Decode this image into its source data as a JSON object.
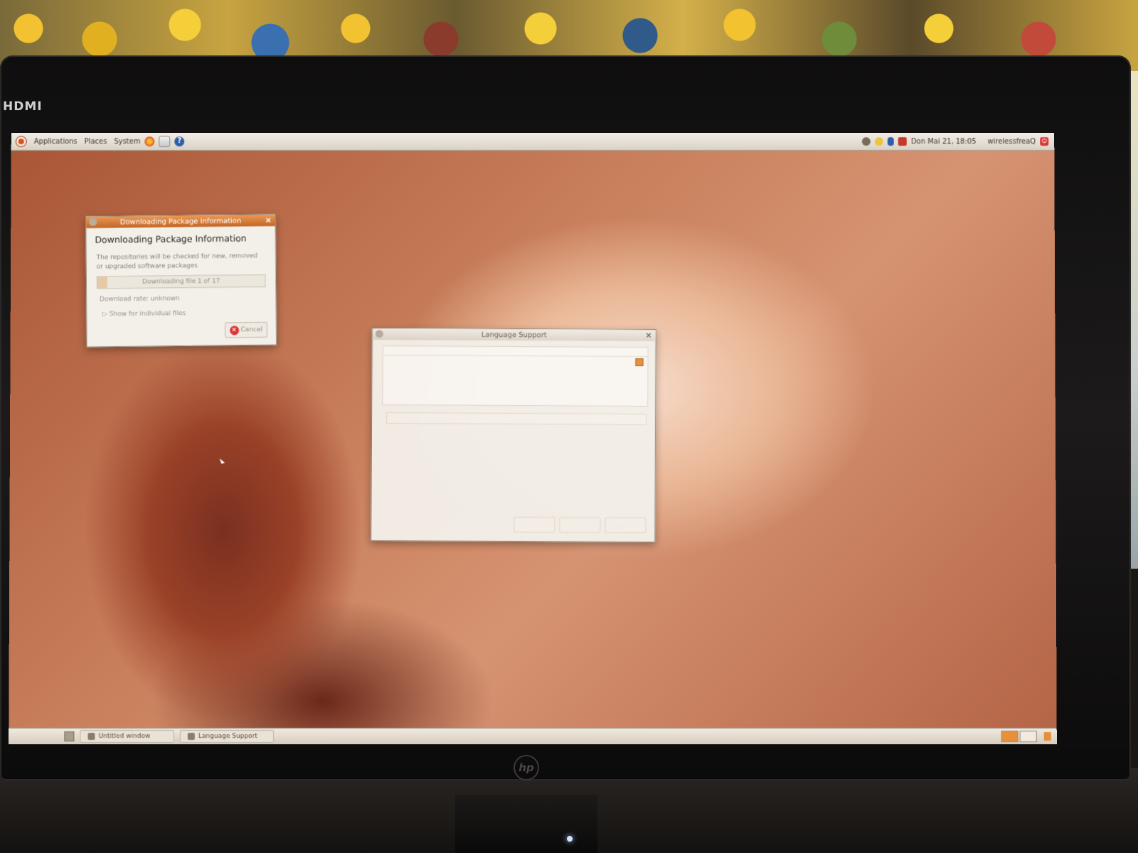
{
  "monitor": {
    "port_label": "HDMI",
    "brand": "hp"
  },
  "top_panel": {
    "menus": [
      "Applications",
      "Places",
      "System"
    ],
    "datetime": "Don Mai 21, 18:05",
    "username": "wirelessfreaQ"
  },
  "download_dialog": {
    "title": "Downloading Package Information",
    "heading": "Downloading Package Information",
    "description": "The repositories will be checked for new, removed or upgraded software packages",
    "progress_text": "Downloading file 1 of 17",
    "progress_fraction": 0.06,
    "rate_text": "Download rate: unknown",
    "expander_label": "Show for individual files",
    "cancel_label": "Cancel"
  },
  "language_dialog": {
    "title": "Language Support"
  },
  "taskbar": {
    "tasks": [
      "Untitled window",
      "Language Support"
    ]
  },
  "colors": {
    "accent": "#e78f3a",
    "title_active": "#d4773a",
    "panel": "#e9e3d8"
  }
}
